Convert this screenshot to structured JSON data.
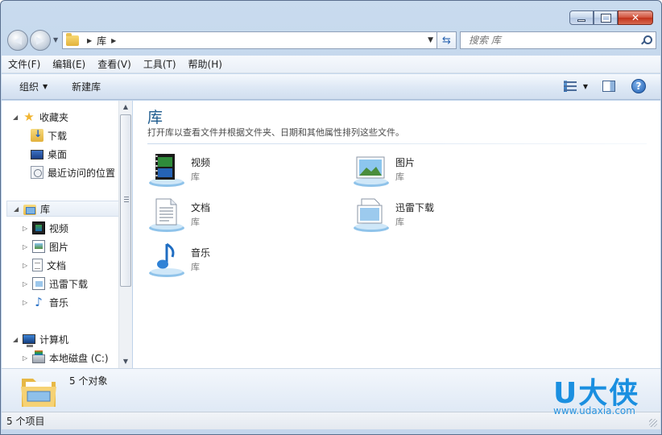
{
  "address": {
    "crumb": "库"
  },
  "search": {
    "placeholder": "搜索 库"
  },
  "menu": [
    "文件(F)",
    "编辑(E)",
    "查看(V)",
    "工具(T)",
    "帮助(H)"
  ],
  "toolbar": {
    "organize": "组织",
    "new_library": "新建库"
  },
  "nav": {
    "favorites": "收藏夹",
    "downloads": "下载",
    "desktop": "桌面",
    "recent": "最近访问的位置",
    "libraries": "库",
    "videos": "视频",
    "pictures": "图片",
    "documents": "文档",
    "xunlei": "迅雷下载",
    "music": "音乐",
    "computer": "计算机",
    "local_disk": "本地磁盘 (C:)"
  },
  "content": {
    "title": "库",
    "description": "打开库以查看文件并根据文件夹、日期和其他属性排列这些文件。",
    "items": [
      {
        "name": "视频",
        "type": "库"
      },
      {
        "name": "图片",
        "type": "库"
      },
      {
        "name": "文档",
        "type": "库"
      },
      {
        "name": "迅雷下载",
        "type": "库"
      },
      {
        "name": "音乐",
        "type": "库"
      }
    ]
  },
  "details": {
    "count": "5 个对象"
  },
  "status": {
    "text": "5 个项目"
  },
  "watermark": {
    "brand": "U大侠",
    "url": "www.udaxia.com"
  },
  "colors": {
    "title_green": "#1e5b8e",
    "close_red": "#c0321b",
    "watermark_blue": "#1a8fe0"
  }
}
